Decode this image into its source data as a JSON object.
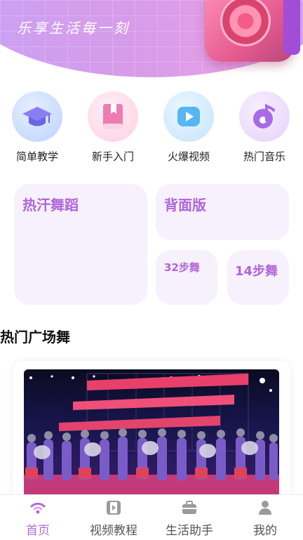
{
  "banner": {
    "title": "乐享生活每一刻"
  },
  "categories": [
    {
      "label": "简单教学",
      "icon": "graduation-cap-icon",
      "color": "#cfe0ff"
    },
    {
      "label": "新手入门",
      "icon": "book-icon",
      "color": "#ffe0ee"
    },
    {
      "label": "火爆视频",
      "icon": "play-icon",
      "color": "#dbeefd"
    },
    {
      "label": "热门音乐",
      "icon": "music-note-icon",
      "color": "#f3e6ff"
    }
  ],
  "tiles": {
    "hot_dance": "热汗舞蹈",
    "back_version": "背面版",
    "steps32": "32步舞",
    "steps14": "14步舞"
  },
  "section": {
    "title": "热门广场舞"
  },
  "nav": [
    {
      "label": "首页",
      "icon": "home-wifi-icon",
      "active": true
    },
    {
      "label": "视频教程",
      "icon": "film-icon",
      "active": false
    },
    {
      "label": "生活助手",
      "icon": "briefcase-icon",
      "active": false
    },
    {
      "label": "我的",
      "icon": "user-icon",
      "active": false
    }
  ],
  "colors": {
    "accent": "#b165d8",
    "tile_bg": "#f6f1fd"
  }
}
